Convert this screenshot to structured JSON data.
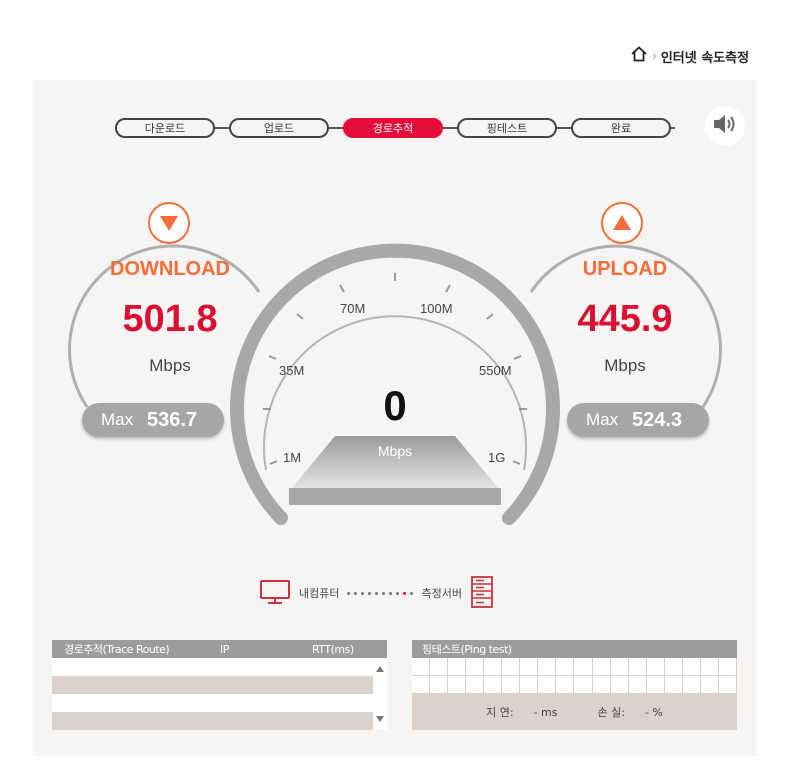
{
  "breadcrumb": {
    "home_icon": "home-icon",
    "separator": "›",
    "current": "인터넷 속도측정"
  },
  "steps": [
    {
      "label": "다운로드",
      "active": false
    },
    {
      "label": "업로드",
      "active": false
    },
    {
      "label": "경로추적",
      "active": true
    },
    {
      "label": "핑테스트",
      "active": false
    },
    {
      "label": "완료",
      "active": false
    }
  ],
  "speaker_icon": "speaker-icon",
  "download": {
    "label": "DOWNLOAD",
    "value": "501.8",
    "unit": "Mbps",
    "max_label": "Max",
    "max_value": "536.7"
  },
  "upload": {
    "label": "UPLOAD",
    "value": "445.9",
    "unit": "Mbps",
    "max_label": "Max",
    "max_value": "524.3"
  },
  "gauge": {
    "value": "0",
    "unit": "Mbps",
    "ticks": [
      "1M",
      "35M",
      "70M",
      "100M",
      "550M",
      "1G"
    ]
  },
  "route": {
    "computer_label": "내컴퓨터",
    "server_label": "측정서버",
    "dots_total": 10,
    "dots_red_index": 8
  },
  "trace_table": {
    "columns": [
      "경로추적(Trace Route)",
      "IP",
      "RTT(ms)"
    ]
  },
  "ping_table": {
    "title": "핑테스트(Ping test)",
    "latency_label": "지 연:",
    "latency_value": "- ms",
    "loss_label": "손 실:",
    "loss_value": "- %"
  },
  "colors": {
    "accent_red": "#e30f3a",
    "orange": "#f46d3a",
    "gauge_gray": "#a9a8a7"
  }
}
